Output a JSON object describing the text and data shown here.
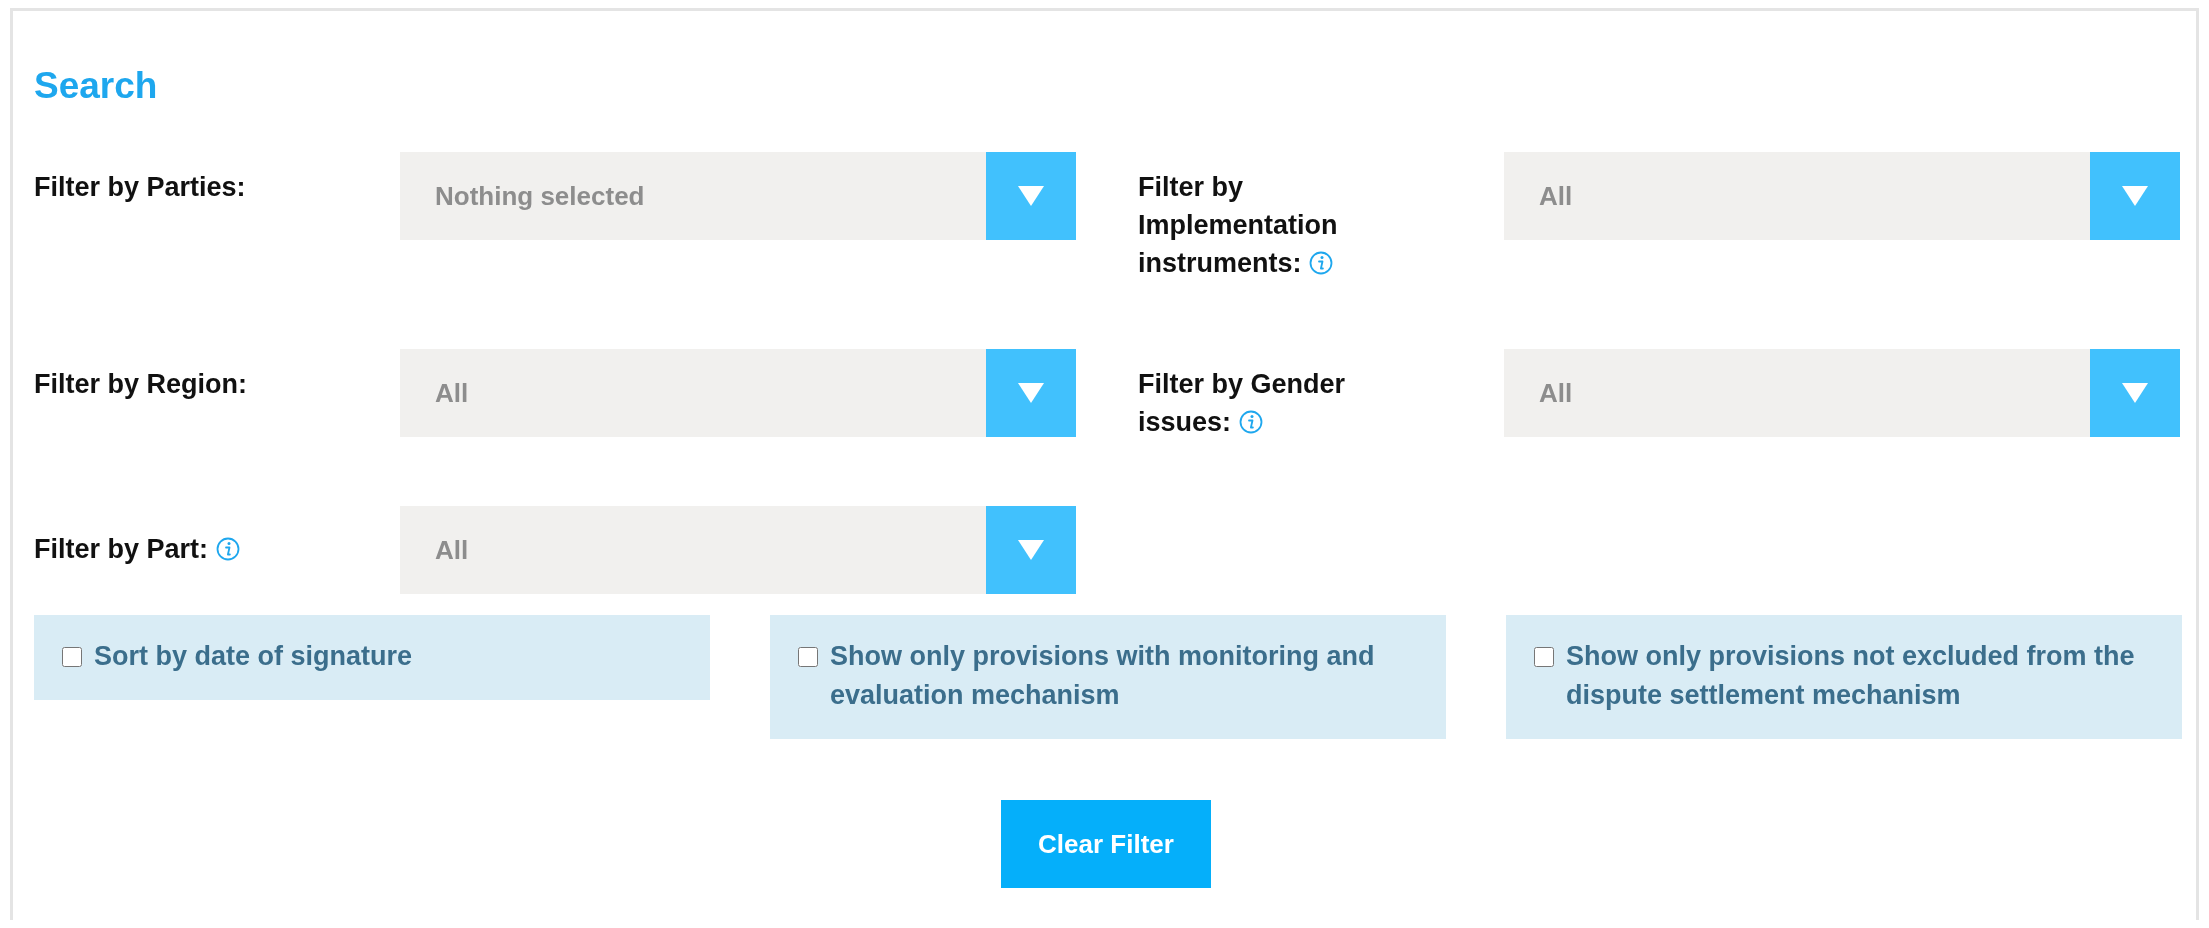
{
  "title": "Search",
  "filters": [
    {
      "label": "Filter by Parties:",
      "info": false,
      "value": "Nothing selected"
    },
    {
      "label": "Filter by Implementation instruments:",
      "info": true,
      "value": "All"
    },
    {
      "label": "Filter by Region:",
      "info": false,
      "value": "All"
    },
    {
      "label": "Filter by Gender issues:",
      "info": true,
      "value": "All"
    },
    {
      "label": "Filter by Part:",
      "info": true,
      "value": "All"
    }
  ],
  "options": [
    {
      "label": "Sort by date of signature",
      "checked": false
    },
    {
      "label": "Show only provisions with monitoring and evaluation mechanism",
      "checked": false
    },
    {
      "label": "Show only provisions not excluded from the dispute settlement mechanism",
      "checked": false
    }
  ],
  "clear_button": "Clear Filter"
}
